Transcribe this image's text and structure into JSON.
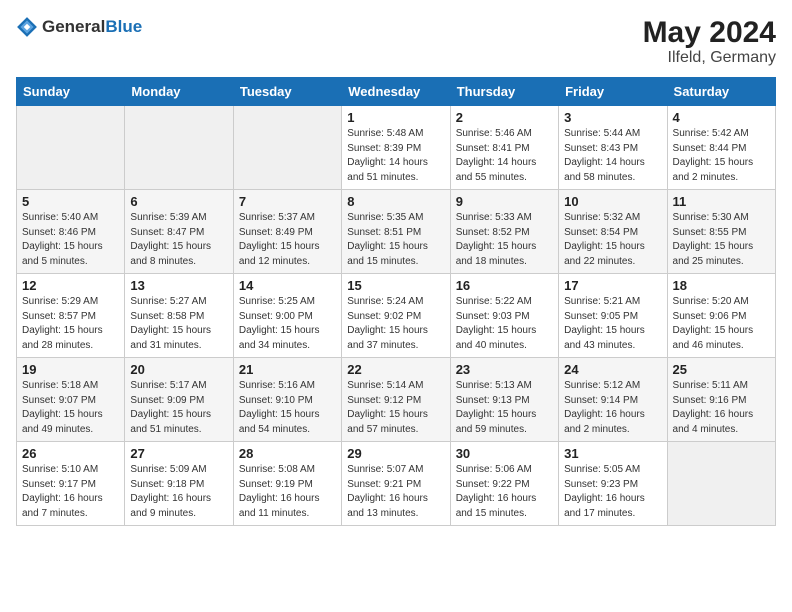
{
  "logo": {
    "text_general": "General",
    "text_blue": "Blue"
  },
  "title": {
    "month_year": "May 2024",
    "location": "Ilfeld, Germany"
  },
  "headers": [
    "Sunday",
    "Monday",
    "Tuesday",
    "Wednesday",
    "Thursday",
    "Friday",
    "Saturday"
  ],
  "weeks": [
    [
      {
        "day": "",
        "info": ""
      },
      {
        "day": "",
        "info": ""
      },
      {
        "day": "",
        "info": ""
      },
      {
        "day": "1",
        "info": "Sunrise: 5:48 AM\nSunset: 8:39 PM\nDaylight: 14 hours\nand 51 minutes."
      },
      {
        "day": "2",
        "info": "Sunrise: 5:46 AM\nSunset: 8:41 PM\nDaylight: 14 hours\nand 55 minutes."
      },
      {
        "day": "3",
        "info": "Sunrise: 5:44 AM\nSunset: 8:43 PM\nDaylight: 14 hours\nand 58 minutes."
      },
      {
        "day": "4",
        "info": "Sunrise: 5:42 AM\nSunset: 8:44 PM\nDaylight: 15 hours\nand 2 minutes."
      }
    ],
    [
      {
        "day": "5",
        "info": "Sunrise: 5:40 AM\nSunset: 8:46 PM\nDaylight: 15 hours\nand 5 minutes."
      },
      {
        "day": "6",
        "info": "Sunrise: 5:39 AM\nSunset: 8:47 PM\nDaylight: 15 hours\nand 8 minutes."
      },
      {
        "day": "7",
        "info": "Sunrise: 5:37 AM\nSunset: 8:49 PM\nDaylight: 15 hours\nand 12 minutes."
      },
      {
        "day": "8",
        "info": "Sunrise: 5:35 AM\nSunset: 8:51 PM\nDaylight: 15 hours\nand 15 minutes."
      },
      {
        "day": "9",
        "info": "Sunrise: 5:33 AM\nSunset: 8:52 PM\nDaylight: 15 hours\nand 18 minutes."
      },
      {
        "day": "10",
        "info": "Sunrise: 5:32 AM\nSunset: 8:54 PM\nDaylight: 15 hours\nand 22 minutes."
      },
      {
        "day": "11",
        "info": "Sunrise: 5:30 AM\nSunset: 8:55 PM\nDaylight: 15 hours\nand 25 minutes."
      }
    ],
    [
      {
        "day": "12",
        "info": "Sunrise: 5:29 AM\nSunset: 8:57 PM\nDaylight: 15 hours\nand 28 minutes."
      },
      {
        "day": "13",
        "info": "Sunrise: 5:27 AM\nSunset: 8:58 PM\nDaylight: 15 hours\nand 31 minutes."
      },
      {
        "day": "14",
        "info": "Sunrise: 5:25 AM\nSunset: 9:00 PM\nDaylight: 15 hours\nand 34 minutes."
      },
      {
        "day": "15",
        "info": "Sunrise: 5:24 AM\nSunset: 9:02 PM\nDaylight: 15 hours\nand 37 minutes."
      },
      {
        "day": "16",
        "info": "Sunrise: 5:22 AM\nSunset: 9:03 PM\nDaylight: 15 hours\nand 40 minutes."
      },
      {
        "day": "17",
        "info": "Sunrise: 5:21 AM\nSunset: 9:05 PM\nDaylight: 15 hours\nand 43 minutes."
      },
      {
        "day": "18",
        "info": "Sunrise: 5:20 AM\nSunset: 9:06 PM\nDaylight: 15 hours\nand 46 minutes."
      }
    ],
    [
      {
        "day": "19",
        "info": "Sunrise: 5:18 AM\nSunset: 9:07 PM\nDaylight: 15 hours\nand 49 minutes."
      },
      {
        "day": "20",
        "info": "Sunrise: 5:17 AM\nSunset: 9:09 PM\nDaylight: 15 hours\nand 51 minutes."
      },
      {
        "day": "21",
        "info": "Sunrise: 5:16 AM\nSunset: 9:10 PM\nDaylight: 15 hours\nand 54 minutes."
      },
      {
        "day": "22",
        "info": "Sunrise: 5:14 AM\nSunset: 9:12 PM\nDaylight: 15 hours\nand 57 minutes."
      },
      {
        "day": "23",
        "info": "Sunrise: 5:13 AM\nSunset: 9:13 PM\nDaylight: 15 hours\nand 59 minutes."
      },
      {
        "day": "24",
        "info": "Sunrise: 5:12 AM\nSunset: 9:14 PM\nDaylight: 16 hours\nand 2 minutes."
      },
      {
        "day": "25",
        "info": "Sunrise: 5:11 AM\nSunset: 9:16 PM\nDaylight: 16 hours\nand 4 minutes."
      }
    ],
    [
      {
        "day": "26",
        "info": "Sunrise: 5:10 AM\nSunset: 9:17 PM\nDaylight: 16 hours\nand 7 minutes."
      },
      {
        "day": "27",
        "info": "Sunrise: 5:09 AM\nSunset: 9:18 PM\nDaylight: 16 hours\nand 9 minutes."
      },
      {
        "day": "28",
        "info": "Sunrise: 5:08 AM\nSunset: 9:19 PM\nDaylight: 16 hours\nand 11 minutes."
      },
      {
        "day": "29",
        "info": "Sunrise: 5:07 AM\nSunset: 9:21 PM\nDaylight: 16 hours\nand 13 minutes."
      },
      {
        "day": "30",
        "info": "Sunrise: 5:06 AM\nSunset: 9:22 PM\nDaylight: 16 hours\nand 15 minutes."
      },
      {
        "day": "31",
        "info": "Sunrise: 5:05 AM\nSunset: 9:23 PM\nDaylight: 16 hours\nand 17 minutes."
      },
      {
        "day": "",
        "info": ""
      }
    ]
  ]
}
